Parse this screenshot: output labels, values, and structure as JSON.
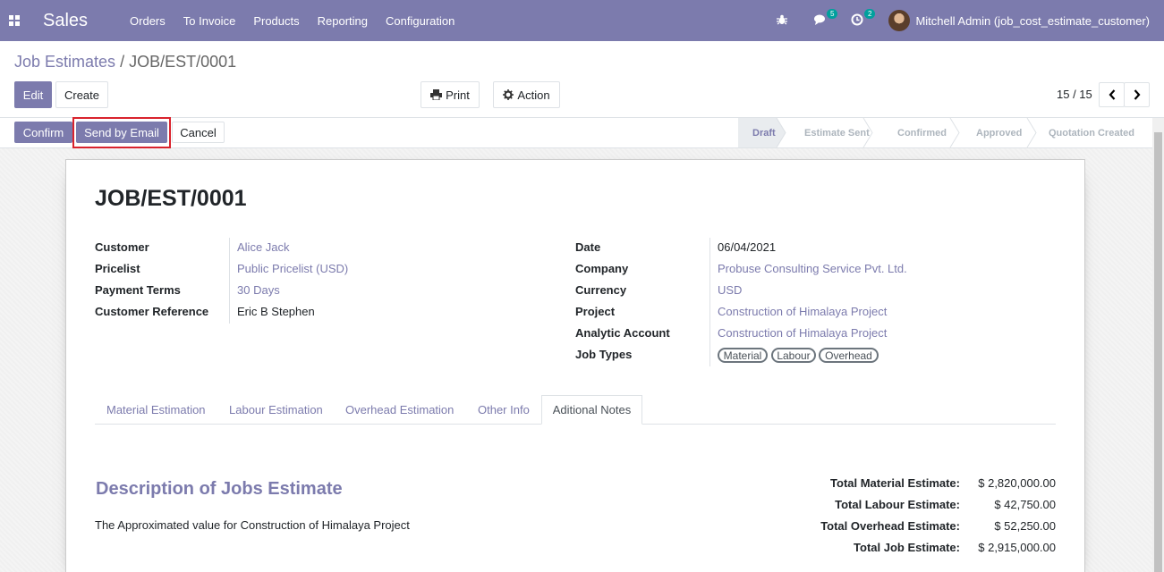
{
  "navbar": {
    "app_name": "Sales",
    "menu": [
      "Orders",
      "To Invoice",
      "Products",
      "Reporting",
      "Configuration"
    ],
    "messages_count": "5",
    "activities_count": "2",
    "user_name": "Mitchell Admin (job_cost_estimate_customer)"
  },
  "breadcrumb": {
    "parent": "Job Estimates",
    "separator": "/",
    "current": "JOB/EST/0001"
  },
  "toolbar": {
    "edit_label": "Edit",
    "create_label": "Create",
    "print_label": "Print",
    "action_label": "Action"
  },
  "pager": {
    "value": "15 / 15"
  },
  "statusbar": {
    "buttons": {
      "confirm": "Confirm",
      "send_by_email": "Send by Email",
      "cancel": "Cancel"
    },
    "steps": [
      "Draft",
      "Estimate Sent",
      "Confirmed",
      "Approved",
      "Quotation Created"
    ],
    "active_step": "Draft"
  },
  "record": {
    "title": "JOB/EST/0001",
    "left_fields": [
      {
        "label": "Customer",
        "value": "Alice Jack"
      },
      {
        "label": "Pricelist",
        "value": "Public Pricelist (USD)"
      },
      {
        "label": "Payment Terms",
        "value": "30 Days"
      },
      {
        "label": "Customer Reference",
        "value": "Eric B Stephen"
      }
    ],
    "right_fields": [
      {
        "label": "Date",
        "value": "06/04/2021"
      },
      {
        "label": "Company",
        "value": "Probuse Consulting Service Pvt. Ltd."
      },
      {
        "label": "Currency",
        "value": "USD"
      },
      {
        "label": "Project",
        "value": "Construction of Himalaya Project"
      },
      {
        "label": "Analytic Account",
        "value": "Construction of Himalaya Project"
      },
      {
        "label": "Job Types",
        "value": ""
      }
    ],
    "job_types": [
      "Material",
      "Labour",
      "Overhead"
    ]
  },
  "tabs": [
    "Material Estimation",
    "Labour Estimation",
    "Overhead Estimation",
    "Other Info",
    "Aditional Notes"
  ],
  "notes": {
    "heading": "Description of Jobs Estimate",
    "text": "The Approximated value for Construction of Himalaya Project"
  },
  "totals": [
    {
      "label": "Total Material Estimate:",
      "value": "$ 2,820,000.00"
    },
    {
      "label": "Total Labour Estimate:",
      "value": "$ 42,750.00"
    },
    {
      "label": "Total Overhead Estimate:",
      "value": "$ 52,250.00"
    },
    {
      "label": "Total Job Estimate:",
      "value": "$ 2,915,000.00"
    }
  ],
  "colors": {
    "brand": "#7c7bad",
    "highlight": "#d9232d"
  }
}
